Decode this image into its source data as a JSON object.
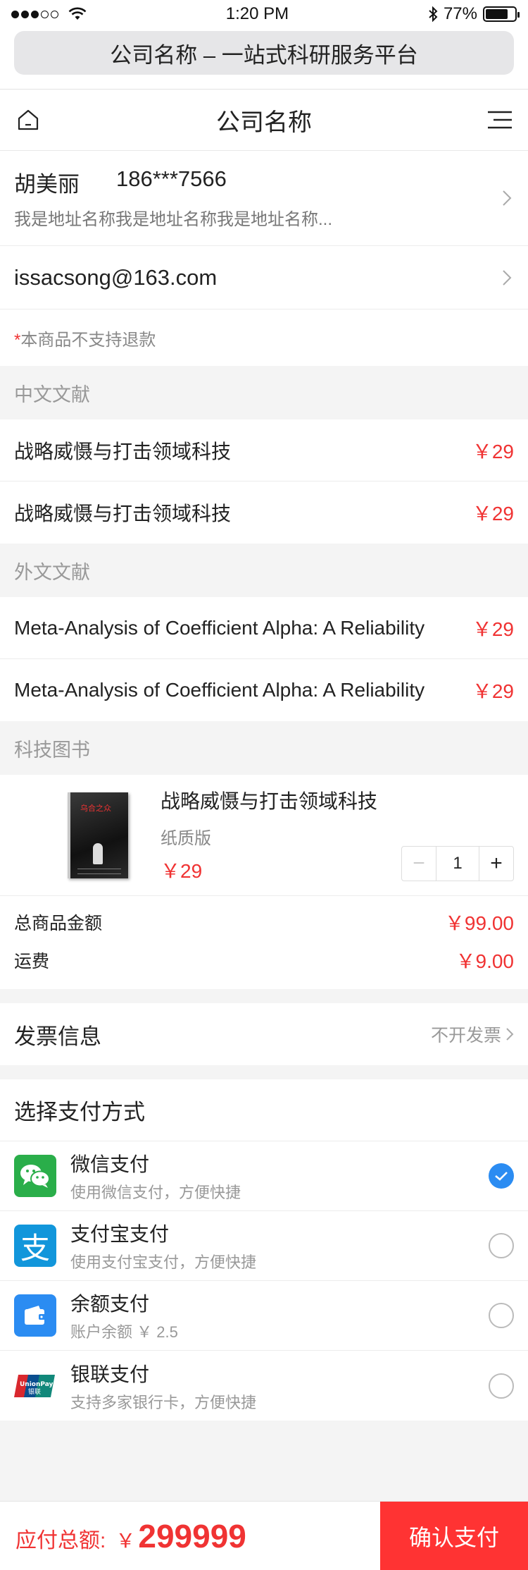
{
  "status_bar": {
    "time": "1:20 PM",
    "battery": "77%",
    "battery_level": 0.77
  },
  "browser": {
    "url_title": "公司名称 – 一站式科研服务平台"
  },
  "nav": {
    "title": "公司名称"
  },
  "address": {
    "name": "胡美丽",
    "phone": "186***7566",
    "detail": "我是地址名称我是地址名称我是地址名称..."
  },
  "email": "issacsong@163.com",
  "notice": {
    "star": "*",
    "text": "本商品不支持退款"
  },
  "groups": {
    "chinese": {
      "title": "中文文献",
      "items": [
        {
          "name": "战略威慑与打击领域科技",
          "price": "￥29"
        },
        {
          "name": "战略威慑与打击领域科技",
          "price": "￥29"
        }
      ]
    },
    "foreign": {
      "title": "外文文献",
      "items": [
        {
          "name": "Meta-Analysis of Coefficient Alpha: A Reliability",
          "price": "￥29"
        },
        {
          "name": "Meta-Analysis of Coefficient Alpha: A Reliability",
          "price": "￥29"
        }
      ]
    },
    "books": {
      "title": "科技图书",
      "item": {
        "name": "战略威慑与打击领域科技",
        "edition": "纸质版",
        "price": "￥29",
        "quantity": "1",
        "cover_title": "乌合之众"
      }
    }
  },
  "totals": {
    "goods_label": "总商品金额",
    "goods_value": "￥99.00",
    "shipping_label": "运费",
    "shipping_value": "￥9.00"
  },
  "invoice": {
    "label": "发票信息",
    "value": "不开发票"
  },
  "payment": {
    "title": "选择支付方式",
    "methods": [
      {
        "name": "微信支付",
        "desc": "使用微信支付，方便快捷",
        "icon": "wechat-pay-icon",
        "color": "#2aae4a",
        "selected": true
      },
      {
        "name": "支付宝支付",
        "desc": "使用支付宝支付，方便快捷",
        "icon": "alipay-icon",
        "color": "#1296db",
        "selected": false
      },
      {
        "name": "余额支付",
        "desc": "账户余额 ￥ 2.5",
        "icon": "wallet-icon",
        "color": "#2b8cf2",
        "selected": false
      },
      {
        "name": "银联支付",
        "desc": "支持多家银行卡，方便快捷",
        "icon": "unionpay-icon",
        "color": "#d9282e",
        "selected": false
      }
    ]
  },
  "footer": {
    "total_label": "应付总额:",
    "currency": "￥",
    "amount": "299999",
    "confirm": "确认支付"
  },
  "colors": {
    "accent_red": "#f03333",
    "confirm_bg": "#ff3333",
    "check_blue": "#2b8cf2"
  }
}
